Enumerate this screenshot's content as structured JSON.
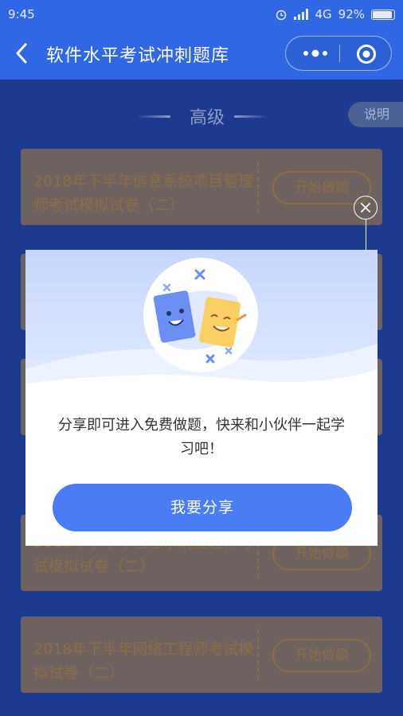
{
  "status_bar": {
    "time": "9:45",
    "network": "4G",
    "battery": "92%"
  },
  "navbar": {
    "title": "软件水平考试冲刺题库"
  },
  "section": {
    "level": "高级",
    "explain": "说明"
  },
  "cards": [
    {
      "title": "2018年下半年信息系统项目管理师考试模拟试卷（二）",
      "button": "开始做题"
    },
    {
      "title": "2018年下半年信息系统监理师考试模拟试卷（二）",
      "button": "开始做题"
    },
    {
      "title": "2018年下半年网络工程师考试模拟试卷（二）",
      "button": "开始做题"
    }
  ],
  "modal": {
    "message": "分享即可进入免费做题，快来和小伙伴一起学习吧！",
    "share_button": "我要分享"
  },
  "colors": {
    "primary": "#2f67e4",
    "share_button": "#4a7cf5",
    "overlay_background": "#1c3a8e",
    "card_accent": "#8a6d45"
  }
}
